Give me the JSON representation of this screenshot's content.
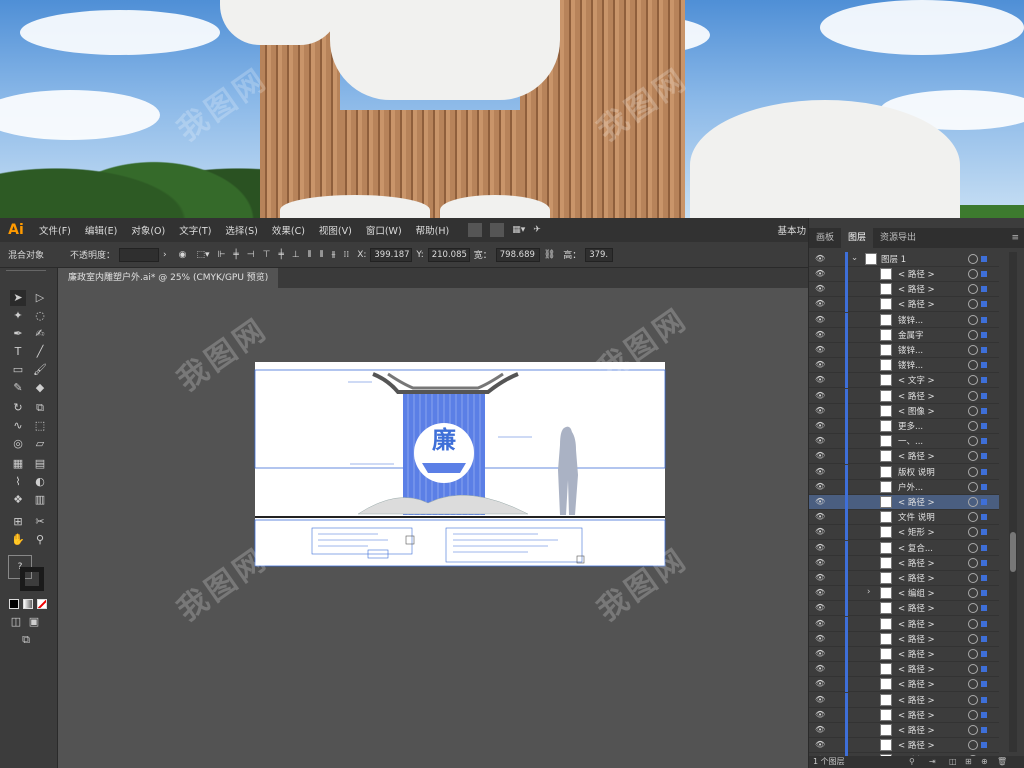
{
  "app": {
    "logo": "Ai"
  },
  "menu": [
    "文件(F)",
    "编辑(E)",
    "对象(O)",
    "文字(T)",
    "选择(S)",
    "效果(C)",
    "视图(V)",
    "窗口(W)",
    "帮助(H)"
  ],
  "workspace": "基本功",
  "control": {
    "mode_label": "混合对象",
    "opacity_label": "不透明度：",
    "x_label": "X:",
    "x_value": "399.187",
    "y_label": "Y:",
    "y_value": "210.085",
    "w_label": "宽：",
    "w_value": "798.689",
    "h_label": "高：",
    "h_value": "379."
  },
  "document_tab": "廉政室内雕塑户外.ai* @ 25% (CMYK/GPU 预览)",
  "panel": {
    "tabs": [
      "画板",
      "图层",
      "资源导出"
    ],
    "active_tab": "图层",
    "parent_layer": "图层 1",
    "layers": [
      "< 路径 >",
      "< 路径 >",
      "< 路径 >",
      "镂锌...",
      "金属字",
      "镂锌...",
      "镂锌...",
      "< 文字 >",
      "< 路径 >",
      "< 图像 >",
      "更多...",
      "一、...",
      "< 路径 >",
      "版权 说明",
      "户外...",
      "< 路径 >",
      "文件 说明",
      "< 矩形 >",
      "< 复合...",
      "< 路径 >",
      "< 路径 >",
      "< 编组 >",
      "< 路径 >",
      "< 路径 >",
      "< 路径 >",
      "< 路径 >",
      "< 路径 >",
      "< 路径 >",
      "< 路径 >",
      "< 路径 >",
      "< 路径 >",
      "< 路径 >",
      "< 路径 >"
    ],
    "selected_index": 15,
    "footer": "1 个图层"
  },
  "artwork": {
    "seal_char": "廉"
  },
  "colors": {
    "accent": "#3e6fd8",
    "ai_orange": "#ff9a00",
    "selection": "#4a5e80"
  }
}
